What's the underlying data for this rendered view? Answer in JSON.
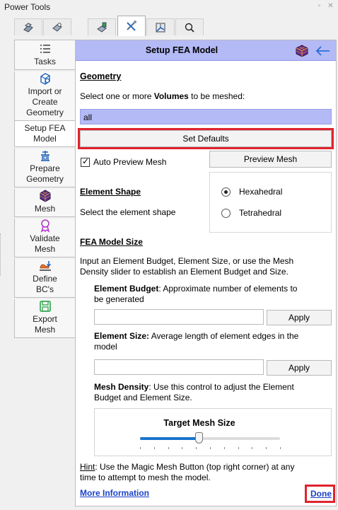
{
  "window": {
    "title": "Power Tools",
    "restore_label": "▫",
    "close_label": "✕"
  },
  "top_tabs": [
    {
      "icon": "geometry-decompose-icon",
      "active": false
    },
    {
      "icon": "geometry-tools-icon",
      "active": false
    },
    {
      "icon": "defeature-icon",
      "active": false
    },
    {
      "icon": "mesh-tools-icon",
      "active": true
    },
    {
      "icon": "mesh-quality-icon",
      "active": false
    },
    {
      "icon": "search-icon",
      "active": false
    }
  ],
  "sidebar": {
    "items": [
      {
        "label": "Tasks",
        "icon": "list-icon"
      },
      {
        "label": "Import or\nCreate\nGeometry",
        "icon": "import-geometry-icon"
      },
      {
        "label": "Setup FEA\nModel",
        "icon": "",
        "active": true
      },
      {
        "label": "Prepare\nGeometry",
        "icon": "prepare-geometry-icon"
      },
      {
        "label": "Mesh",
        "icon": "mesh-cube-icon"
      },
      {
        "label": "Validate\nMesh",
        "icon": "validate-ribbon-icon"
      },
      {
        "label": "Define\nBC's",
        "icon": "define-bc-icon"
      },
      {
        "label": "Export\nMesh",
        "icon": "export-save-icon"
      }
    ]
  },
  "header": {
    "title": "Setup FEA Model"
  },
  "geometry": {
    "title": "Geometry",
    "prompt_pre": "Select one or more ",
    "prompt_bold": "Volumes",
    "prompt_post": " to be meshed:",
    "volumes_value": "all",
    "set_defaults_label": "Set Defaults"
  },
  "preview": {
    "auto_preview_label": "Auto Preview Mesh",
    "auto_preview_checked": true,
    "preview_button_label": "Preview Mesh"
  },
  "element_shape": {
    "title": "Element Shape",
    "description": "Select the element shape",
    "options": [
      {
        "label": "Hexahedral",
        "selected": true
      },
      {
        "label": "Tetrahedral",
        "selected": false
      }
    ]
  },
  "fea_size": {
    "title": "FEA Model Size",
    "intro_line1": "Input an Element Budget, Element Size, or use the Mesh",
    "intro_line2": "Density slider to establish an Element Budget and Size.",
    "budget_label": "Element Budget",
    "budget_desc_line1": ": Approximate number of elements to",
    "budget_desc_line2": "be generated",
    "budget_value": "",
    "budget_apply_label": "Apply",
    "size_label": "Element Size:",
    "size_desc_line1": " Average length of element edges in the",
    "size_desc_line2": "model",
    "size_value": "",
    "size_apply_label": "Apply",
    "density_label": "Mesh Density",
    "density_desc_line1": ": Use this control to adjust the Element",
    "density_desc_line2": "Budget and Element Size.",
    "slider_label": "Target Mesh Size",
    "slider_value": 0.42,
    "slider_ticks": 11
  },
  "hint": {
    "label": "Hint",
    "line1": ": Use the Magic Mesh Button (top right corner) at any",
    "line2": "time to attempt to mesh the model."
  },
  "footer": {
    "more_info_label": "More Information",
    "done_label": "Done"
  }
}
